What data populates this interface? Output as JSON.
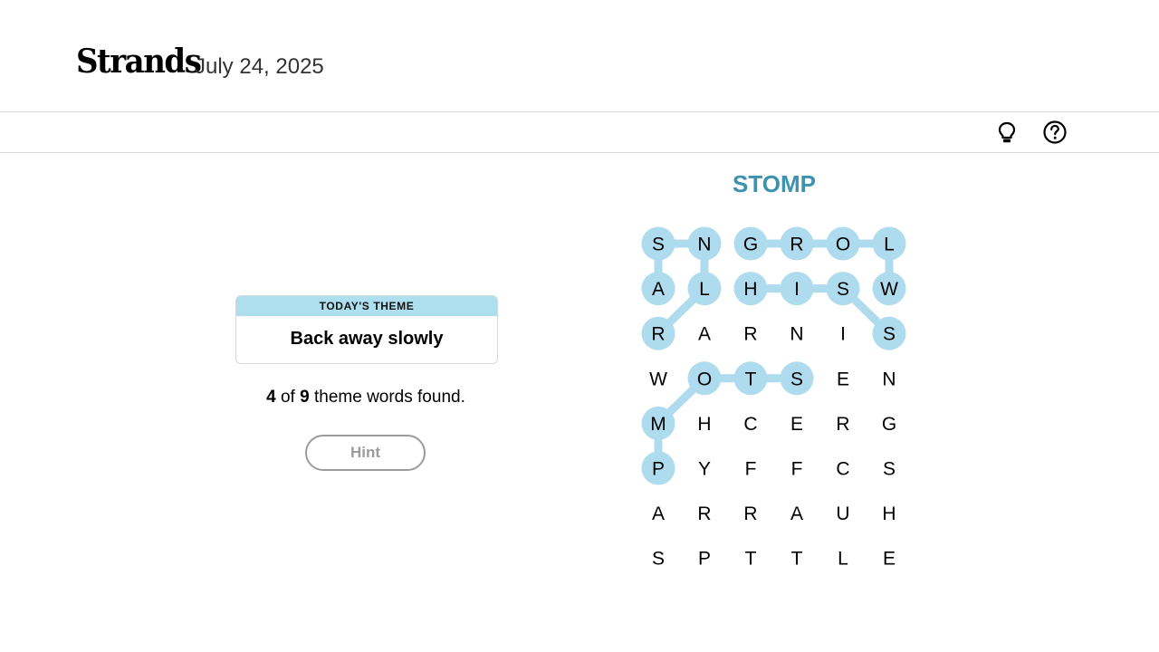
{
  "header": {
    "logo": "Strands",
    "date": "July 24, 2025"
  },
  "toolbar": {
    "icons": [
      "lightbulb-icon",
      "help-circle-icon"
    ]
  },
  "theme": {
    "label": "TODAY'S THEME",
    "title": "Back away slowly"
  },
  "progress": {
    "found": "4",
    "of_label": "of",
    "total": "9",
    "suffix": "theme words found."
  },
  "hint_button": {
    "label": "Hint"
  },
  "current_word": "STOMP",
  "colors": {
    "highlight": "#aedcee",
    "current_word": "#3c93b0",
    "theme_header": "#aedfee"
  },
  "board": {
    "columns": 6,
    "rows": [
      [
        "S",
        "N",
        "G",
        "R",
        "O",
        "L"
      ],
      [
        "A",
        "L",
        "H",
        "I",
        "S",
        "W"
      ],
      [
        "R",
        "A",
        "R",
        "N",
        "I",
        "S"
      ],
      [
        "W",
        "O",
        "T",
        "S",
        "E",
        "N"
      ],
      [
        "M",
        "H",
        "C",
        "E",
        "R",
        "G"
      ],
      [
        "P",
        "Y",
        "F",
        "F",
        "C",
        "S"
      ],
      [
        "A",
        "R",
        "R",
        "A",
        "U",
        "H"
      ],
      [
        "S",
        "P",
        "T",
        "T",
        "L",
        "E"
      ]
    ],
    "found_paths": [
      [
        [
          1,
          0
        ],
        [
          0,
          0
        ],
        [
          0,
          1
        ],
        [
          1,
          1
        ],
        [
          2,
          0
        ]
      ],
      [
        [
          1,
          2
        ],
        [
          1,
          3
        ],
        [
          1,
          4
        ],
        [
          2,
          5
        ]
      ],
      [
        [
          0,
          2
        ],
        [
          0,
          3
        ],
        [
          0,
          4
        ],
        [
          0,
          5
        ],
        [
          1,
          5
        ]
      ],
      [
        [
          3,
          3
        ],
        [
          3,
          2
        ],
        [
          3,
          1
        ],
        [
          4,
          0
        ],
        [
          5,
          0
        ]
      ]
    ]
  }
}
